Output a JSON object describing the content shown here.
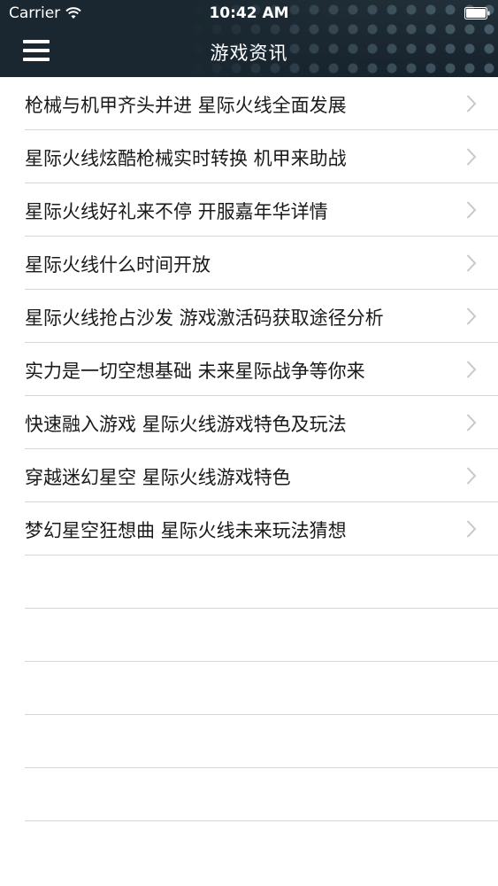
{
  "status_bar": {
    "carrier": "Carrier",
    "time": "10:42 AM"
  },
  "nav": {
    "title": "游戏资讯",
    "menu_icon": "hamburger-menu-icon"
  },
  "articles": [
    {
      "label": "枪械与机甲齐头并进 星际火线全面发展"
    },
    {
      "label": "星际火线炫酷枪械实时转换 机甲来助战"
    },
    {
      "label": "星际火线好礼来不停 开服嘉年华详情"
    },
    {
      "label": "星际火线什么时间开放"
    },
    {
      "label": "星际火线抢占沙发 游戏激活码获取途径分析"
    },
    {
      "label": "实力是一切空想基础 未来星际战争等你来"
    },
    {
      "label": "快速融入游戏 星际火线游戏特色及玩法"
    },
    {
      "label": "穿越迷幻星空 星际火线游戏特色"
    },
    {
      "label": "梦幻星空狂想曲 星际火线未来玩法猜想"
    }
  ],
  "colors": {
    "header_bg": "#18242c",
    "text": "#1a1a1a",
    "separator": "#d6d6d9",
    "chevron": "#c7c7cc"
  }
}
